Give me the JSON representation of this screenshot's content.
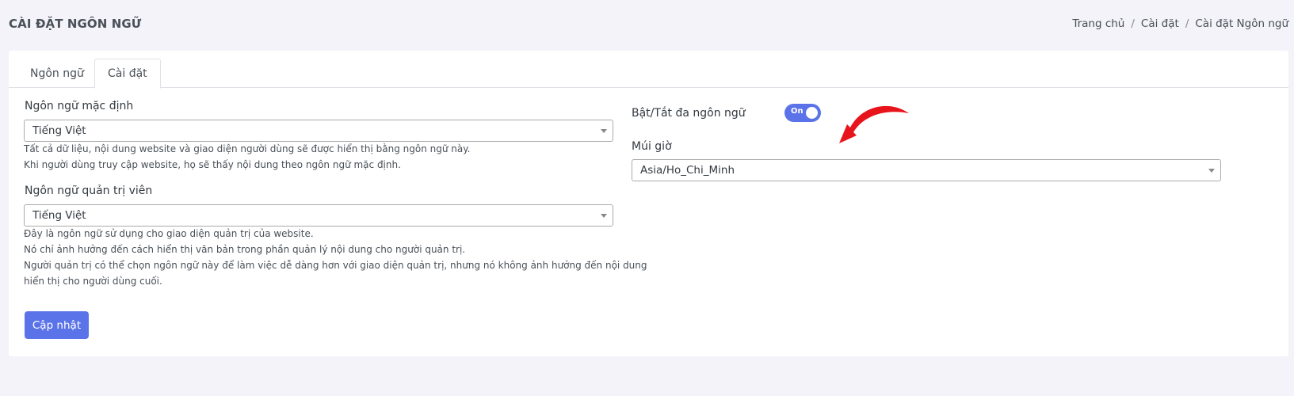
{
  "header": {
    "title": "CÀI ĐẶT NGÔN NGỮ",
    "breadcrumb": [
      "Trang chủ",
      "Cài đặt",
      "Cài đặt Ngôn ngữ"
    ],
    "separator": "/"
  },
  "tabs": [
    {
      "label": "Ngôn ngữ",
      "active": false
    },
    {
      "label": "Cài đặt",
      "active": true
    }
  ],
  "default_language": {
    "label": "Ngôn ngữ mặc định",
    "value": "Tiếng Việt",
    "help": [
      "Tất cả dữ liệu, nội dung website và giao diện người dùng sẽ được hiển thị bằng ngôn ngữ này.",
      "Khi người dùng truy cập website, họ sẽ thấy nội dung theo ngôn ngữ mặc định."
    ]
  },
  "admin_language": {
    "label": "Ngôn ngữ quản trị viên",
    "value": "Tiếng Việt",
    "help": [
      "Đây là ngôn ngữ sử dụng cho giao diện quản trị của website.",
      "Nó chỉ ảnh hưởng đến cách hiển thị văn bản trong phần quản lý nội dung cho người quản trị.",
      "Người quản trị có thể chọn ngôn ngữ này để làm việc dễ dàng hơn với giao diện quản trị, nhưng nó không ảnh hưởng đến nội dung",
      "hiển thị cho người dùng cuối."
    ]
  },
  "multilang": {
    "label": "Bật/Tắt đa ngôn ngữ",
    "toggle_text": "On",
    "enabled": true
  },
  "timezone": {
    "label": "Múi giờ",
    "value": "Asia/Ho_Chi_Minh"
  },
  "submit_label": "Cập nhật",
  "colors": {
    "primary": "#5b73e8",
    "annotation_arrow": "#e8141c",
    "background": "#f3f3f9"
  }
}
